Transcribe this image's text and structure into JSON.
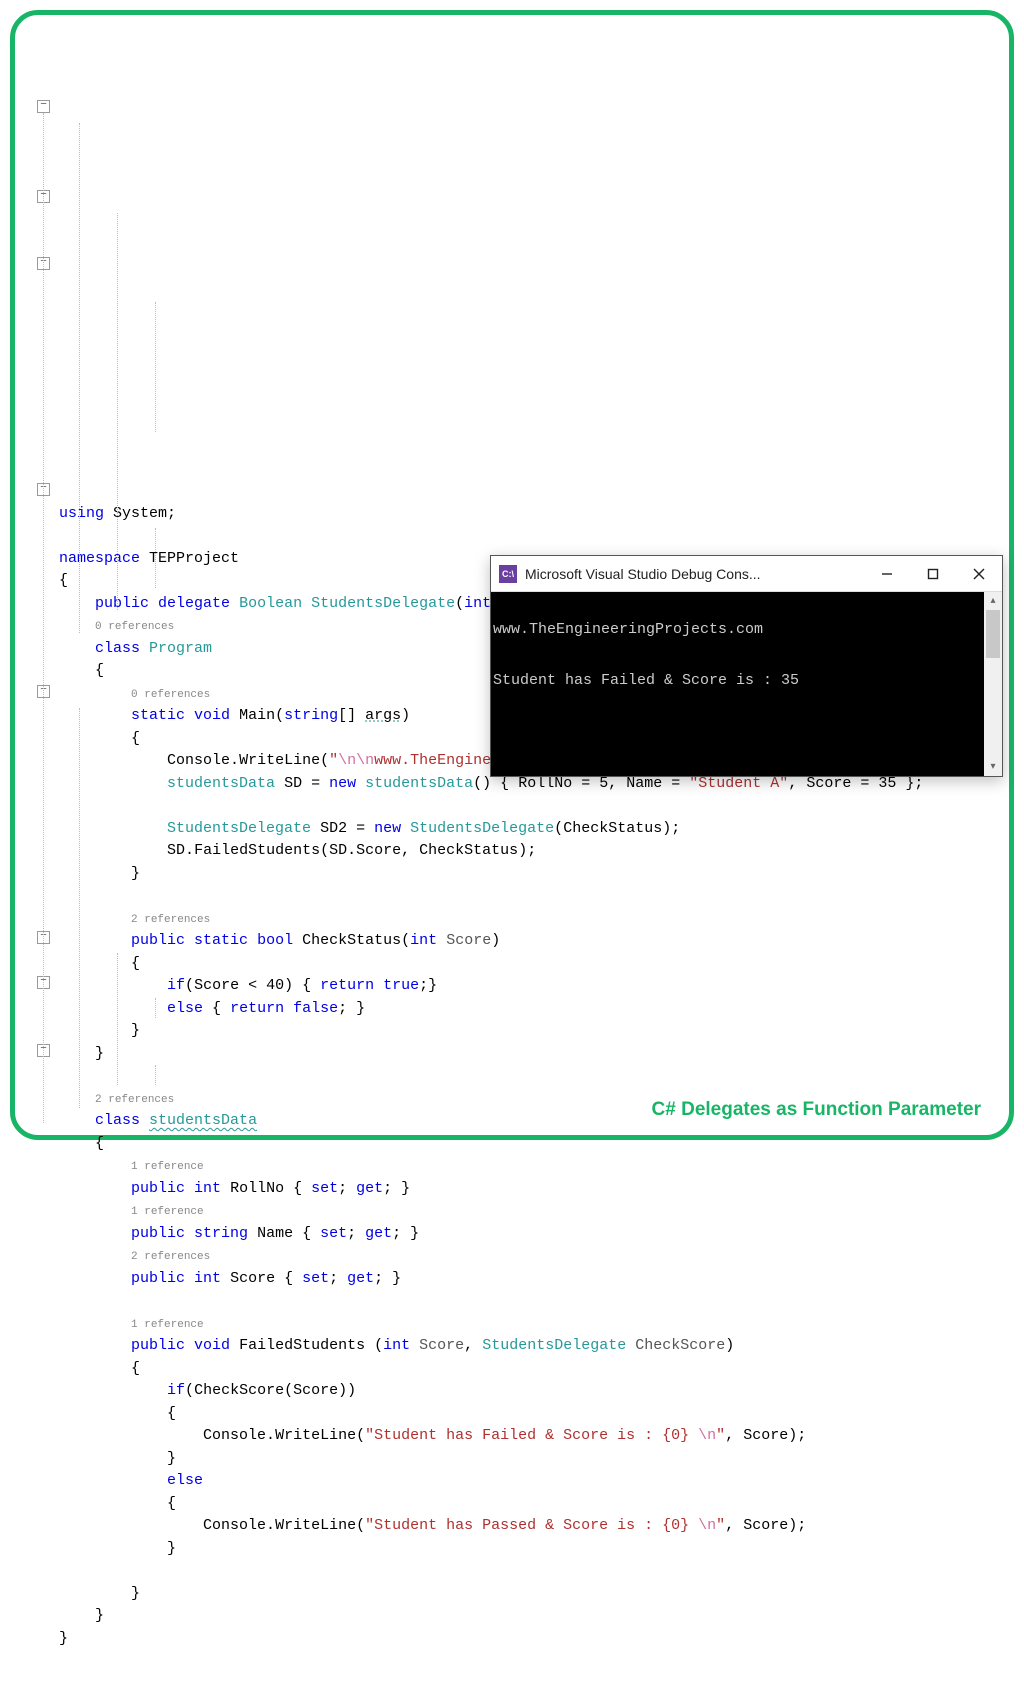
{
  "caption": "C# Delegates as Function Parameter",
  "refs": {
    "zero": "0 references",
    "one": "1 reference",
    "two": "2 references"
  },
  "code": {
    "using": "using",
    "system": "System",
    "namespace": "namespace",
    "project": "TEPProject",
    "public": "public",
    "delegate": "delegate",
    "boolean": "Boolean",
    "studentsDelegate": "StudentsDelegate",
    "int": "int",
    "score": "score",
    "class": "class",
    "program": "Program",
    "static": "static",
    "void": "void",
    "main": "Main",
    "string": "string",
    "args": "args",
    "console": "Console",
    "writeLine": "WriteLine",
    "url": "www.TheEngineeringProjects.com",
    "esc_nn": "\\n\\n",
    "esc_n": "\\n",
    "studentsData": "studentsData",
    "sd": "SD",
    "new": "new",
    "rollNo": "RollNo",
    "five": "5",
    "name": "Name",
    "studentA": "\"Student A\"",
    "scoreProp": "Score",
    "thirtyfive": "35",
    "sd2": "SD2",
    "checkStatus": "CheckStatus",
    "failedStudents": "FailedStudents",
    "bool": "bool",
    "scoreParam": "Score",
    "if": "if",
    "lt40": "40",
    "return": "return",
    "true": "true",
    "false": "false",
    "else": "else",
    "set": "set",
    "get": "get",
    "checkScore": "CheckScore",
    "failedMsg": "\"Student has Failed & Score is : {0} ",
    "passedMsg": "\"Student has Passed & Score is : {0} "
  },
  "console": {
    "title": "Microsoft Visual Studio Debug Cons...",
    "icon": "C:\\",
    "line1": "www.TheEngineeringProjects.com",
    "line2": "Student has Failed & Score is : 35"
  }
}
